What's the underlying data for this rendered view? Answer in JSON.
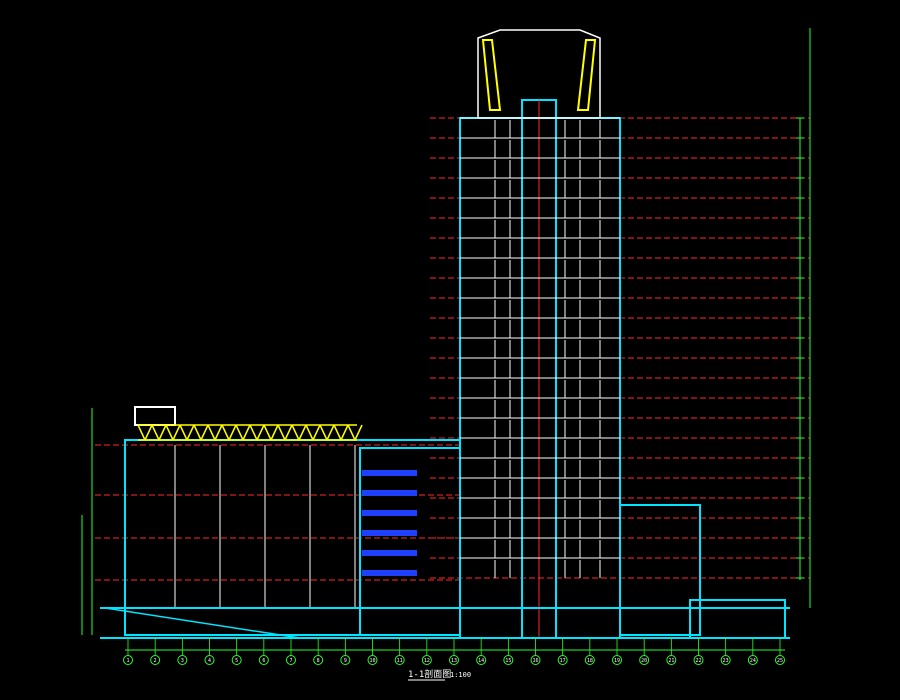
{
  "drawing": {
    "title": "1-1剖面图",
    "scale": "1:100",
    "colors": {
      "background": "#000000",
      "structure": "#00e5ff",
      "floor_line": "#ff2a2a",
      "dimension": "#2cff2c",
      "truss": "#ffff00",
      "glass": "#2040ff",
      "text": "#ffffff",
      "axis_bubble": "#2cff2c"
    },
    "tower_floor_count": 23,
    "podium_floor_count": 5,
    "axis_labels": [
      "1",
      "2",
      "3",
      "4",
      "5",
      "6",
      "7",
      "8",
      "9",
      "10",
      "11",
      "12",
      "13",
      "14",
      "15",
      "16",
      "17",
      "18",
      "19",
      "20",
      "21",
      "22",
      "23",
      "24",
      "25"
    ]
  }
}
